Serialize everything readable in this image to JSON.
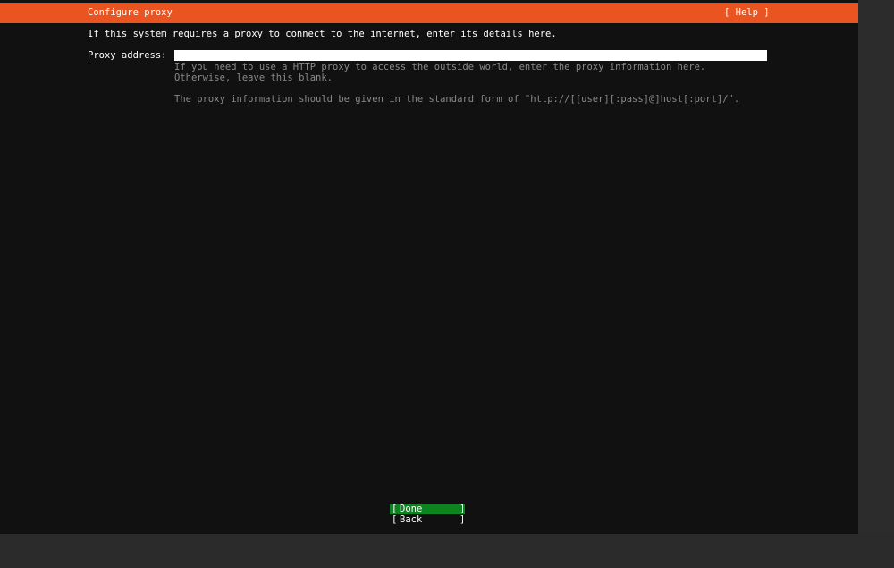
{
  "header": {
    "title": "Configure proxy",
    "help_label": "[ Help ]",
    "color": "#e95420"
  },
  "intro": "If this system requires a proxy to connect to the internet, enter its details here.",
  "proxy_field": {
    "label": "Proxy address:",
    "value": "",
    "help_lines": [
      "If you need to use a HTTP proxy to access the outside world, enter the proxy information here. Otherwise, leave this blank.",
      "The proxy information should be given in the standard form of \"http://[[user][:pass]@]host[:port]/\"."
    ]
  },
  "buttons": {
    "done": {
      "accel": "D",
      "rest": "one",
      "left_bracket": "[",
      "right_bracket": "]",
      "focused_color": "#0e8420"
    },
    "back": {
      "label": "Back",
      "left_bracket": "[",
      "right_bracket": "]"
    }
  }
}
